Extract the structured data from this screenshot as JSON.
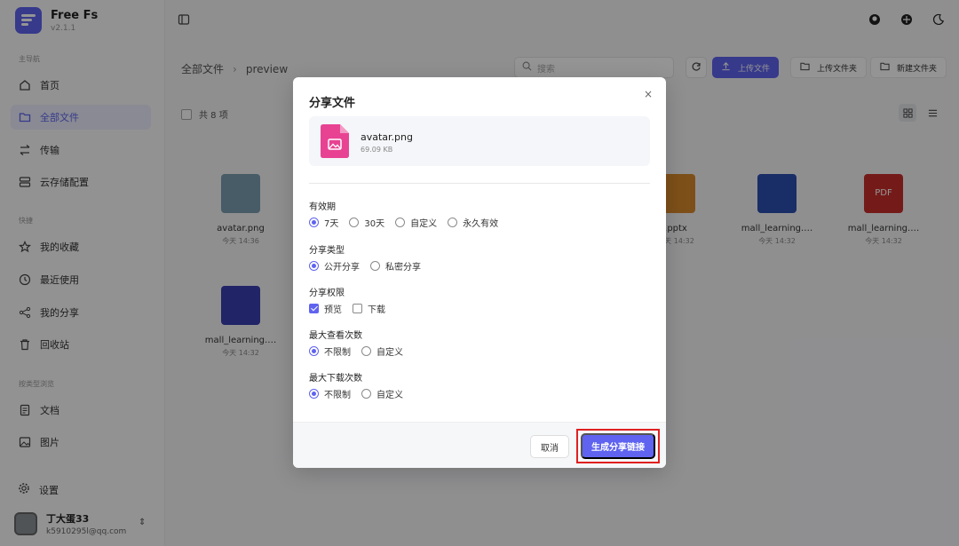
{
  "app": {
    "name": "Free Fs",
    "version": "v2.1.1"
  },
  "sidebar": {
    "sections": {
      "main": "主导航",
      "quick": "快捷",
      "categories": "按类型浏览"
    },
    "items": [
      {
        "label": "首页",
        "icon": "home-icon"
      },
      {
        "label": "全部文件",
        "icon": "folder-icon",
        "active": true
      },
      {
        "label": "传输",
        "icon": "transfer-icon"
      },
      {
        "label": "云存储配置",
        "icon": "storage-icon"
      },
      {
        "label": "我的收藏",
        "icon": "star-icon"
      },
      {
        "label": "最近使用",
        "icon": "clock-icon"
      },
      {
        "label": "我的分享",
        "icon": "share-icon"
      },
      {
        "label": "回收站",
        "icon": "trash-icon"
      },
      {
        "label": "文档",
        "icon": "document-icon"
      },
      {
        "label": "图片",
        "icon": "image-icon"
      }
    ],
    "settings_label": "设置",
    "user": {
      "name": "丁大蛋33",
      "email": "k5910295l@qq.com"
    }
  },
  "main": {
    "breadcrumb": [
      "全部文件",
      "preview"
    ],
    "search_placeholder": "搜索",
    "buttons": {
      "upload_file": "上传文件",
      "upload_folder": "上传文件夹",
      "new_folder": "新建文件夹"
    },
    "selection_count": "共 8 项",
    "files": [
      {
        "name": "avatar.png",
        "date": "今天 14:36",
        "type": "image"
      },
      {
        "name": ".pptx",
        "date": "今天 14:32",
        "type": "pptx"
      },
      {
        "name": "mall_learning.…",
        "date": "今天 14:32",
        "type": "word"
      },
      {
        "name": "mall_learning.…",
        "date": "今天 14:32",
        "type": "pdf",
        "badge": "PDF"
      },
      {
        "name": "mall_learning.…",
        "date": "今天 14:32",
        "type": "doc"
      }
    ]
  },
  "modal": {
    "title": "分享文件",
    "close_symbol": "×",
    "file": {
      "name": "avatar.png",
      "size": "69.09 KB"
    },
    "validity": {
      "label": "有效期",
      "options": [
        "7天",
        "30天",
        "自定义",
        "永久有效"
      ],
      "selected": 0
    },
    "share_type": {
      "label": "分享类型",
      "options": [
        "公开分享",
        "私密分享"
      ],
      "selected": 0
    },
    "permissions": {
      "label": "分享权限",
      "options": [
        "预览",
        "下载"
      ],
      "checked": [
        true,
        false
      ]
    },
    "max_views": {
      "label": "最大查看次数",
      "options": [
        "不限制",
        "自定义"
      ],
      "selected": 0
    },
    "max_downloads": {
      "label": "最大下载次数",
      "options": [
        "不限制",
        "自定义"
      ],
      "selected": 0
    },
    "cancel_label": "取消",
    "generate_label": "生成分享链接"
  },
  "colors": {
    "accent": "#5f63f0",
    "highlight": "#e02020",
    "pdf": "#c9302c",
    "word": "#2b4fb0",
    "image_pink": "#e84393"
  }
}
